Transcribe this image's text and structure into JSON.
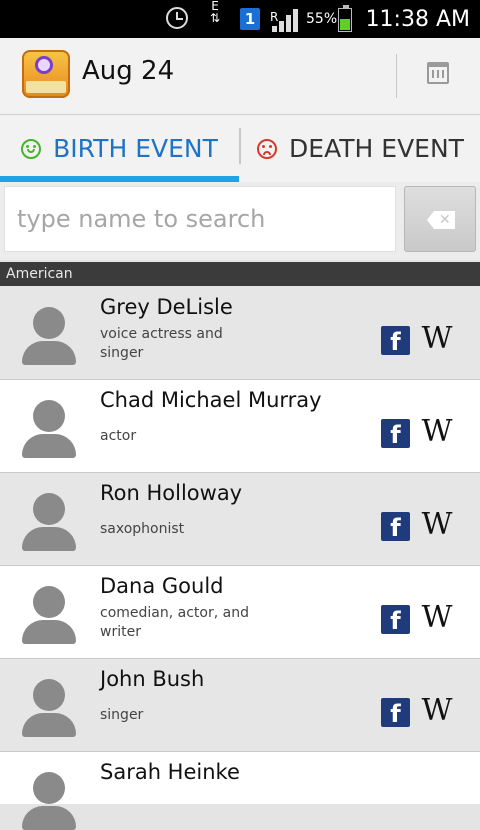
{
  "status_bar": {
    "time": "11:38 AM",
    "battery": "55%",
    "network_type": "E",
    "sim_badge": "1",
    "roaming": "R"
  },
  "action_bar": {
    "date": "Aug 24",
    "icons": [
      "app-logo",
      "calendar-icon"
    ]
  },
  "tabs": [
    {
      "label": "BIRTH EVENT",
      "selected": true,
      "icon": "happy-face-icon"
    },
    {
      "label": "DEATH EVENT",
      "selected": false,
      "icon": "sad-face-icon"
    }
  ],
  "search": {
    "placeholder": "type name to search"
  },
  "section": {
    "title": "American"
  },
  "people": [
    {
      "name": "Grey DeLisle",
      "description": "voice actress and singer"
    },
    {
      "name": "Chad Michael Murray",
      "description": "actor"
    },
    {
      "name": "Ron Holloway",
      "description": "saxophonist"
    },
    {
      "name": "Dana Gould",
      "description": "comedian, actor, and writer"
    },
    {
      "name": "John Bush",
      "description": "singer"
    },
    {
      "name": "Sarah Heinke",
      "description": ""
    }
  ],
  "link_icons": {
    "facebook": "f",
    "wikipedia": "W"
  },
  "colors": {
    "tab_selected": "#1f73c7",
    "tab_indicator": "#1aa3e6",
    "facebook": "#1f3b7b",
    "battery": "#5fcf2a"
  }
}
